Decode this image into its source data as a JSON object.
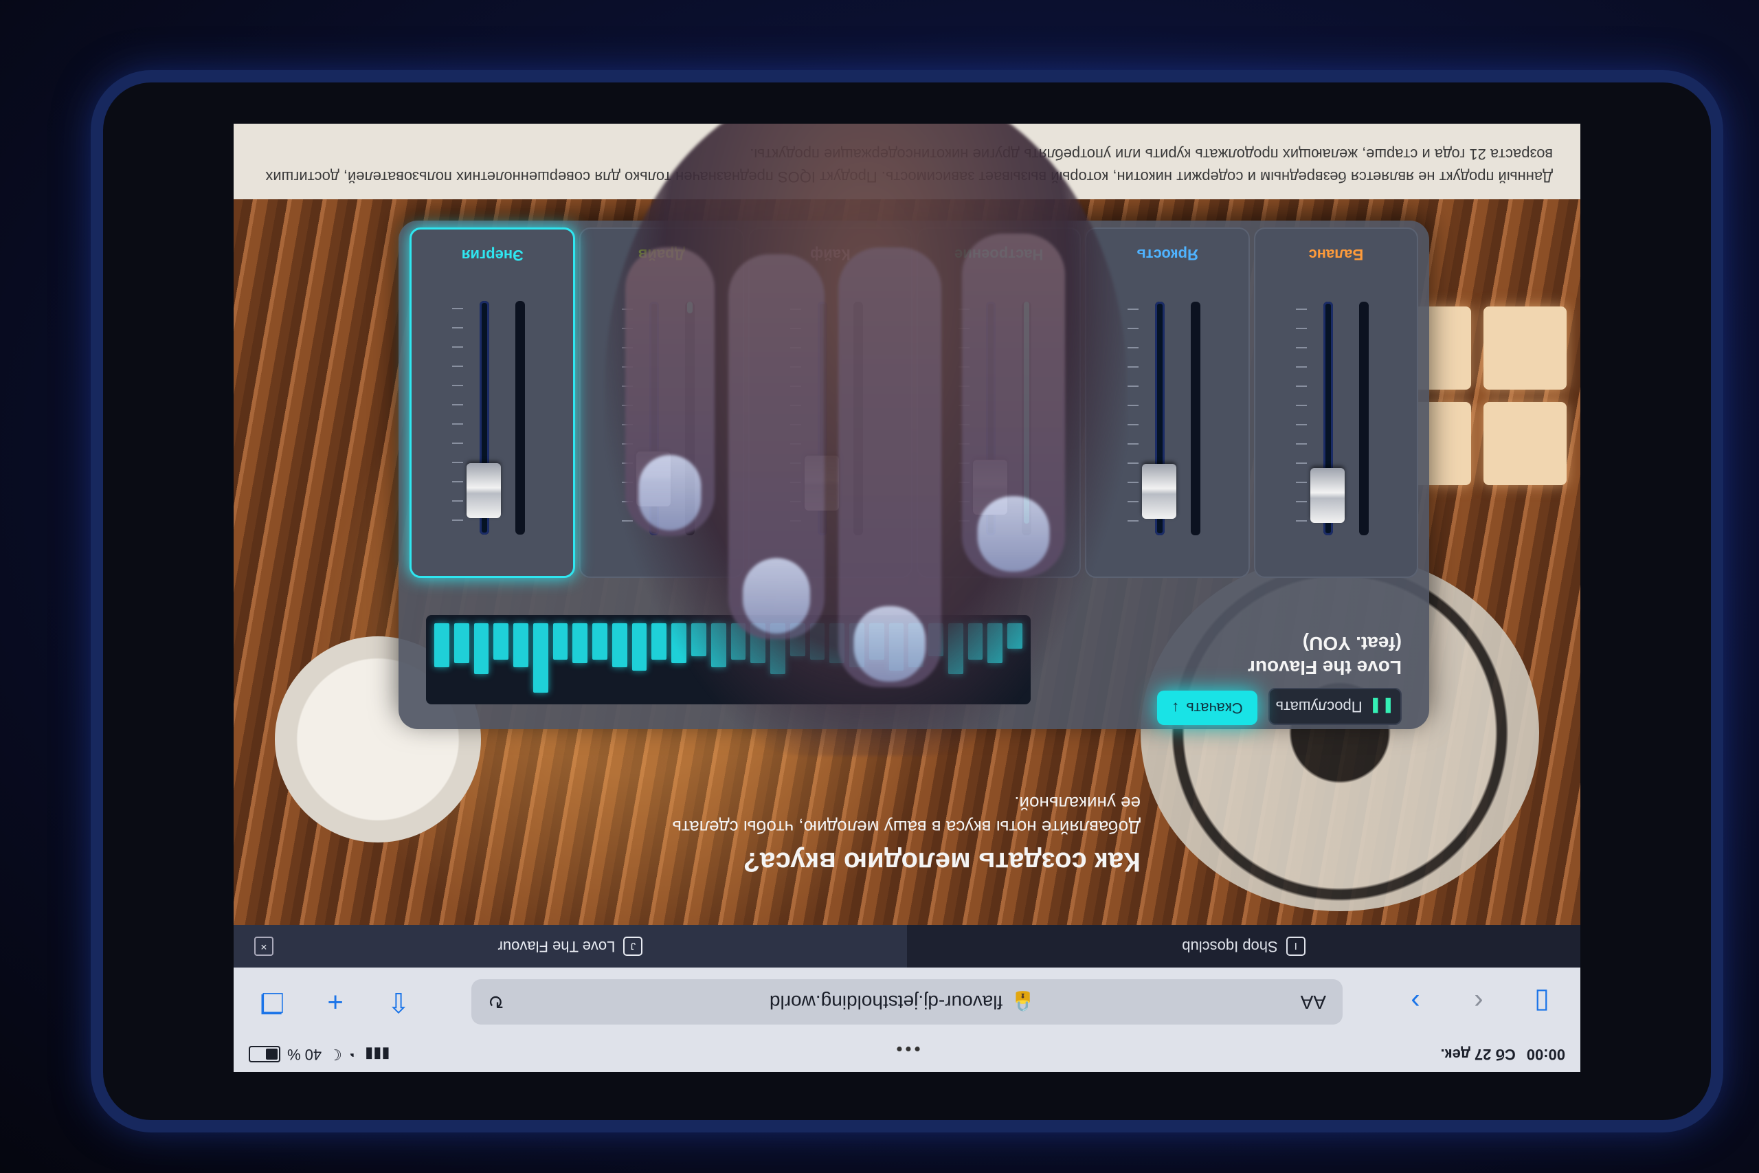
{
  "status_bar": {
    "time": "00:00",
    "date": "Сб 27 дек.",
    "battery": "40 %",
    "multitask": "•••"
  },
  "toolbar": {
    "sidebar_icon": "sidebar-icon",
    "back_icon": "chevron-left-icon",
    "forward_icon": "chevron-right-icon",
    "reader_label": "AA",
    "url": "flavour-dj.jetstholding.world",
    "lock_icon": "lock-icon",
    "reload_icon": "reload-icon",
    "share_icon": "share-icon",
    "new_tab_icon": "plus-icon",
    "tabs_icon": "tabs-icon"
  },
  "tabs": [
    {
      "label": "Shop Iqosclub",
      "icon_text": "I",
      "active": false
    },
    {
      "label": "Love The Flavour",
      "icon_text": "J",
      "active": true,
      "close": "×"
    }
  ],
  "page": {
    "headline": "Как создать мелодию вкуса?",
    "subtext": "Добавляйте ноты вкуса в вашу мелодию, чтобы сделать ее уникальной."
  },
  "mixer": {
    "song_title": "Love the Flavour",
    "song_subtitle": "(feat. YOU)",
    "play_label": "Прослушать",
    "download_label": "Скачать",
    "meter_levels": [
      0.35,
      0.55,
      0.5,
      0.7,
      0.45,
      0.6,
      0.65,
      0.5,
      0.6,
      0.55,
      0.5,
      0.45,
      0.7,
      0.55,
      0.5,
      0.6,
      0.45,
      0.55,
      0.5,
      0.65,
      0.6,
      0.5,
      0.55,
      0.5,
      0.95,
      0.6,
      0.5,
      0.7,
      0.55,
      0.6
    ],
    "channels": [
      {
        "label": "Баланс",
        "color": "#ff9b3a",
        "level": 0.0,
        "fader": 0.94,
        "selected": false
      },
      {
        "label": "Яркость",
        "color": "#4fb3ff",
        "level": 0.0,
        "fader": 0.92,
        "selected": false
      },
      {
        "label": "Настроение",
        "color": "#3ef0c0",
        "level": 0.95,
        "fader": 0.9,
        "selected": false
      },
      {
        "label": "Кайф",
        "color": "#d8c8ff",
        "level": 0.0,
        "fader": 0.88,
        "selected": false
      },
      {
        "label": "Драйв",
        "color": "#b4f03a",
        "level": 0.05,
        "fader": 0.86,
        "selected": false
      },
      {
        "label": "Энергия",
        "color": "#2fe6f0",
        "level": 0.0,
        "fader": 0.92,
        "selected": true
      }
    ]
  },
  "legal": {
    "text": "Данный продукт не является безвредным и содержит никотин, который вызывает зависимость. Продукт IQOS предназначен только для совершеннолетних пользователей, достигших возраста 21 года и старше, желающих продолжать курить или употреблять другие никотинсодержащие продукты."
  },
  "colors": {
    "accent": "#19e3e6",
    "ios_blue": "#1b74e8"
  }
}
